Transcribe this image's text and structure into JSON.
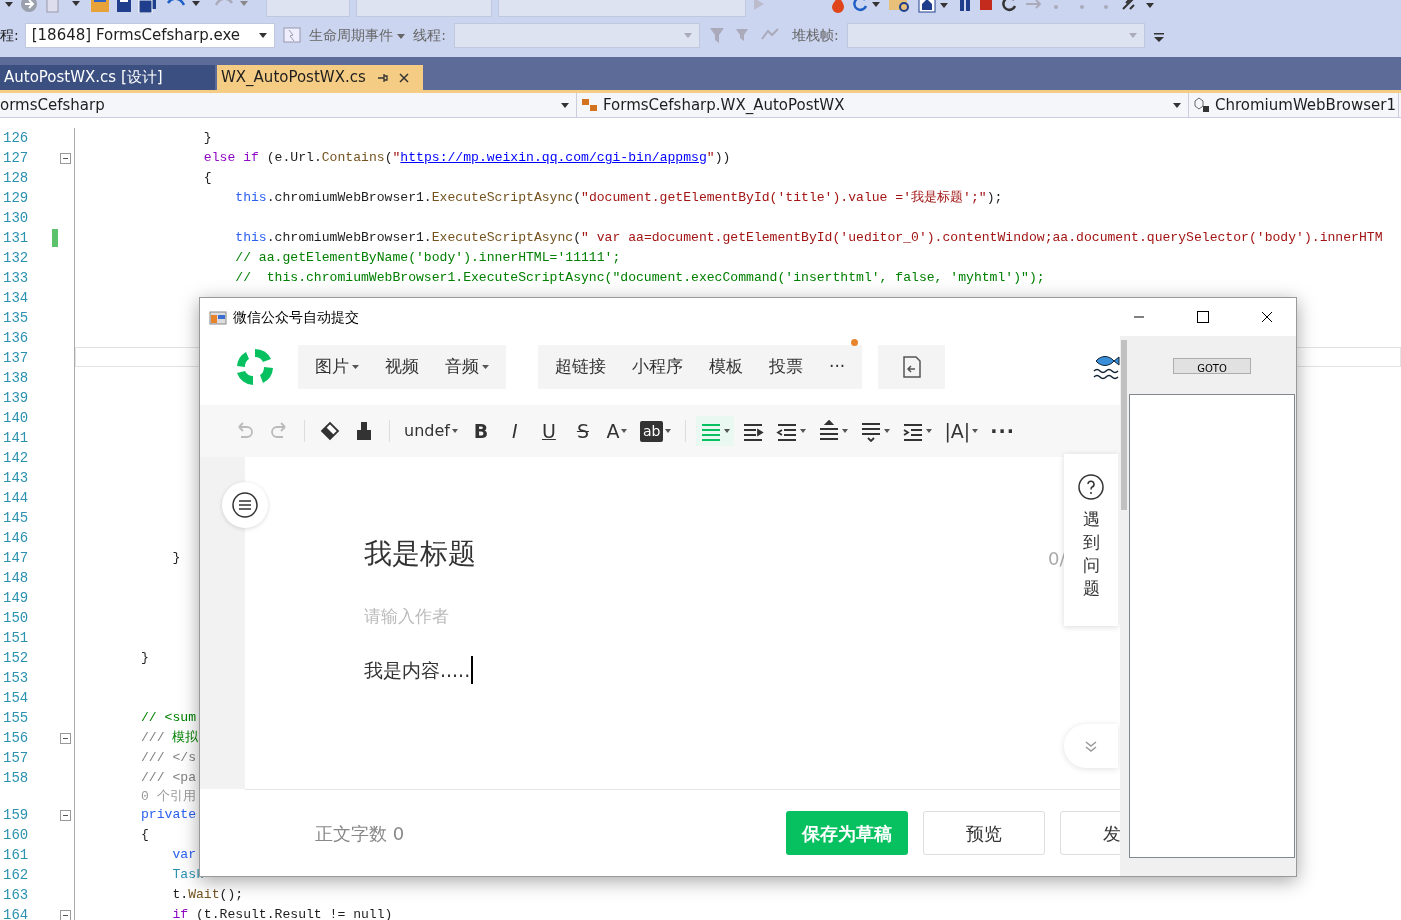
{
  "ide_toolbar": {
    "process_label": "程:",
    "process": "[18648] FormsCefsharp.exe",
    "lifecycle_events": "生命周期事件",
    "thread_label": "线程:",
    "stack_frame_label": "堆栈帧:"
  },
  "tabs": [
    {
      "label": "AutoPostWX.cs [设计]",
      "selected": false
    },
    {
      "label": "WX_AutoPostWX.cs",
      "selected": true
    }
  ],
  "navigation": [
    "ormsCefsharp",
    "FormsCefsharp.WX_AutoPostWX",
    "ChromiumWebBrowser1"
  ],
  "code_lines": [
    {
      "kind": "code",
      "number": "126",
      "fold": false,
      "changed": false,
      "segments": [
        {
          "kind": "plain",
          "text": "                }"
        }
      ]
    },
    {
      "kind": "code",
      "number": "127",
      "fold": true,
      "changed": false,
      "segments": [
        {
          "kind": "control",
          "text": "                else if"
        },
        {
          "kind": "plain",
          "text": " (e.Url."
        },
        {
          "kind": "method",
          "text": "Contains"
        },
        {
          "kind": "plain",
          "text": "("
        },
        {
          "kind": "string",
          "text": "\""
        },
        {
          "kind": "link",
          "text": "https://mp.weixin.qq.com/cgi-bin/appmsg"
        },
        {
          "kind": "string",
          "text": "\""
        },
        {
          "kind": "plain",
          "text": "))"
        }
      ]
    },
    {
      "kind": "code",
      "number": "128",
      "fold": false,
      "changed": false,
      "segments": [
        {
          "kind": "plain",
          "text": "                {"
        }
      ]
    },
    {
      "kind": "code",
      "number": "129",
      "fold": false,
      "changed": false,
      "segments": [
        {
          "kind": "keyword",
          "text": "                    this"
        },
        {
          "kind": "plain",
          "text": ".chromiumWebBrowser1."
        },
        {
          "kind": "method",
          "text": "ExecuteScriptAsync"
        },
        {
          "kind": "plain",
          "text": "("
        },
        {
          "kind": "string",
          "text": "\"document.getElementById('title').value ='我是标题';\""
        },
        {
          "kind": "plain",
          "text": ");"
        }
      ]
    },
    {
      "kind": "code",
      "number": "130",
      "fold": false,
      "changed": false
    },
    {
      "kind": "code",
      "number": "131",
      "fold": false,
      "changed": true,
      "segments": [
        {
          "kind": "keyword",
          "text": "                    this"
        },
        {
          "kind": "plain",
          "text": ".chromiumWebBrowser1."
        },
        {
          "kind": "method",
          "text": "ExecuteScriptAsync"
        },
        {
          "kind": "plain",
          "text": "("
        },
        {
          "kind": "string",
          "text": "\" var aa=document.getElementById('ueditor_0').contentWindow;aa.document.querySelector('body').innerHTM"
        }
      ]
    },
    {
      "kind": "code",
      "number": "132",
      "fold": false,
      "changed": false,
      "segments": [
        {
          "kind": "comment",
          "text": "                    // aa.getElementByName('body').innerHTML='11111';"
        }
      ]
    },
    {
      "kind": "code",
      "number": "133",
      "fold": false,
      "changed": false,
      "segments": [
        {
          "kind": "comment",
          "text": "                    //  this.chromiumWebBrowser1.ExecuteScriptAsync(\"document.execCommand('inserthtml', false, 'myhtml')\");"
        }
      ]
    },
    {
      "kind": "code",
      "number": "134",
      "fold": false,
      "changed": false
    },
    {
      "kind": "code",
      "number": "135",
      "fold": false,
      "changed": false
    },
    {
      "kind": "code",
      "number": "136",
      "fold": false,
      "changed": false
    },
    {
      "kind": "code",
      "number": "137",
      "fold": false,
      "changed": false
    },
    {
      "kind": "code",
      "number": "138",
      "fold": false,
      "changed": false
    },
    {
      "kind": "code",
      "number": "139",
      "fold": false,
      "changed": false
    },
    {
      "kind": "code",
      "number": "140",
      "fold": false,
      "changed": false
    },
    {
      "kind": "code",
      "number": "141",
      "fold": false,
      "changed": false
    },
    {
      "kind": "code",
      "number": "142",
      "fold": false,
      "changed": false
    },
    {
      "kind": "code",
      "number": "143",
      "fold": false,
      "changed": false
    },
    {
      "kind": "code",
      "number": "144",
      "fold": false,
      "changed": false
    },
    {
      "kind": "code",
      "number": "145",
      "fold": false,
      "changed": false
    },
    {
      "kind": "code",
      "number": "146",
      "fold": false,
      "changed": false
    },
    {
      "kind": "code",
      "number": "147",
      "fold": false,
      "changed": false,
      "segments": [
        {
          "kind": "plain",
          "text": "            }"
        }
      ]
    },
    {
      "kind": "code",
      "number": "148",
      "fold": false,
      "changed": false
    },
    {
      "kind": "code",
      "number": "149",
      "fold": false,
      "changed": false
    },
    {
      "kind": "code",
      "number": "150",
      "fold": false,
      "changed": false
    },
    {
      "kind": "code",
      "number": "151",
      "fold": false,
      "changed": false
    },
    {
      "kind": "code",
      "number": "152",
      "fold": false,
      "changed": false,
      "segments": [
        {
          "kind": "plain",
          "text": "        }"
        }
      ]
    },
    {
      "kind": "code",
      "number": "153",
      "fold": false,
      "changed": false
    },
    {
      "kind": "code",
      "number": "154",
      "fold": false,
      "changed": false
    },
    {
      "kind": "code",
      "number": "155",
      "fold": false,
      "changed": false,
      "segments": [
        {
          "kind": "comment",
          "text": "        // <sum"
        }
      ]
    },
    {
      "kind": "code",
      "number": "156",
      "fold": true,
      "changed": false,
      "segments": [
        {
          "kind": "doc",
          "text": "        ///"
        },
        {
          "kind": "comment",
          "text": " 模拟"
        }
      ]
    },
    {
      "kind": "code",
      "number": "157",
      "fold": false,
      "changed": false,
      "segments": [
        {
          "kind": "doc",
          "text": "        /// </s"
        }
      ]
    },
    {
      "kind": "code",
      "number": "158",
      "fold": false,
      "changed": false,
      "segments": [
        {
          "kind": "doc",
          "text": "        /// <pa"
        }
      ]
    },
    {
      "kind": "lens",
      "fold": false,
      "changed": false,
      "segments": [
        {
          "kind": "lens",
          "text": "        0 个引用"
        }
      ]
    },
    {
      "kind": "code",
      "number": "159",
      "fold": true,
      "changed": false,
      "segments": [
        {
          "kind": "keyword",
          "text": "        private"
        }
      ]
    },
    {
      "kind": "code",
      "number": "160",
      "fold": false,
      "changed": false,
      "segments": [
        {
          "kind": "plain",
          "text": "        {"
        }
      ]
    },
    {
      "kind": "code",
      "number": "161",
      "fold": false,
      "changed": false,
      "segments": [
        {
          "kind": "keyword",
          "text": "            var"
        }
      ]
    },
    {
      "kind": "code",
      "number": "162",
      "fold": false,
      "changed": false,
      "segments": [
        {
          "kind": "type",
          "text": "            Task"
        }
      ]
    },
    {
      "kind": "code",
      "number": "163",
      "fold": false,
      "changed": false,
      "segments": [
        {
          "kind": "plain",
          "text": "            t."
        },
        {
          "kind": "method",
          "text": "Wait"
        },
        {
          "kind": "plain",
          "text": "();"
        }
      ]
    },
    {
      "kind": "code",
      "number": "164",
      "fold": true,
      "changed": false,
      "segments": [
        {
          "kind": "control",
          "text": "            if"
        },
        {
          "kind": "plain",
          "text": " (t.Result.Result != null)"
        }
      ]
    }
  ],
  "dialog": {
    "title": "微信公众号自动提交",
    "menu_groups": [
      {
        "items": [
          {
            "label": "图片",
            "dropdown": true,
            "notice": false
          },
          {
            "label": "视频",
            "dropdown": false,
            "notice": false
          },
          {
            "label": "音频",
            "dropdown": true,
            "notice": false
          }
        ]
      },
      {
        "items": [
          {
            "label": "超链接",
            "dropdown": false,
            "notice": false
          },
          {
            "label": "小程序",
            "dropdown": false,
            "notice": false
          },
          {
            "label": "模板",
            "dropdown": false,
            "notice": false
          },
          {
            "label": "投票",
            "dropdown": false,
            "notice": false
          },
          {
            "label": "···",
            "dropdown": false,
            "notice": true
          }
        ]
      }
    ],
    "tools": [
      {
        "kind": "undo",
        "dropdown": false,
        "disabled": true,
        "active": false
      },
      {
        "kind": "redo",
        "dropdown": false,
        "disabled": true,
        "active": false
      },
      {
        "kind": "separator"
      },
      {
        "kind": "eraser",
        "dropdown": false,
        "disabled": false,
        "active": false
      },
      {
        "kind": "brush",
        "dropdown": false,
        "disabled": false,
        "active": false
      },
      {
        "kind": "separator"
      },
      {
        "kind": "font-size",
        "label": "undef",
        "dropdown": true,
        "disabled": false,
        "active": false
      },
      {
        "kind": "bold",
        "label": "B",
        "dropdown": false,
        "disabled": false,
        "active": false
      },
      {
        "kind": "italic",
        "label": "I",
        "dropdown": false,
        "disabled": false,
        "active": false
      },
      {
        "kind": "underline",
        "label": "U",
        "dropdown": false,
        "disabled": false,
        "active": false
      },
      {
        "kind": "strike",
        "label": "S",
        "dropdown": false,
        "disabled": false,
        "active": false
      },
      {
        "kind": "font-color",
        "label": "A",
        "dropdown": true,
        "disabled": false,
        "active": false
      },
      {
        "kind": "highlight",
        "label": "ab",
        "dropdown": true,
        "disabled": false,
        "active": false
      },
      {
        "kind": "separator"
      },
      {
        "kind": "justify",
        "dropdown": true,
        "disabled": false,
        "active": true
      },
      {
        "kind": "indent-right",
        "dropdown": false,
        "disabled": false,
        "active": false
      },
      {
        "kind": "outdent",
        "dropdown": true,
        "disabled": false,
        "active": false
      },
      {
        "kind": "line-height",
        "dropdown": true,
        "disabled": false,
        "active": false
      },
      {
        "kind": "spacing",
        "dropdown": true,
        "disabled": false,
        "active": false
      },
      {
        "kind": "indent",
        "dropdown": true,
        "disabled": false,
        "active": false
      },
      {
        "kind": "letter-spacing",
        "label": "|A|",
        "dropdown": true,
        "disabled": false,
        "active": false
      },
      {
        "kind": "more",
        "label": "···",
        "dropdown": false,
        "disabled": false,
        "active": false
      }
    ],
    "article_title": "我是标题",
    "title_count": "0/",
    "author_placeholder": "请输入作者",
    "content": "我是内容.....",
    "help": "遇到问题",
    "word_count_label": "正文字数",
    "word_count": "0",
    "buttons": [
      {
        "label": "保存为草稿",
        "kind": "primary"
      },
      {
        "label": "预览",
        "kind": "default"
      },
      {
        "label": "发",
        "kind": "default"
      }
    ],
    "goto_button": "GOTO"
  }
}
